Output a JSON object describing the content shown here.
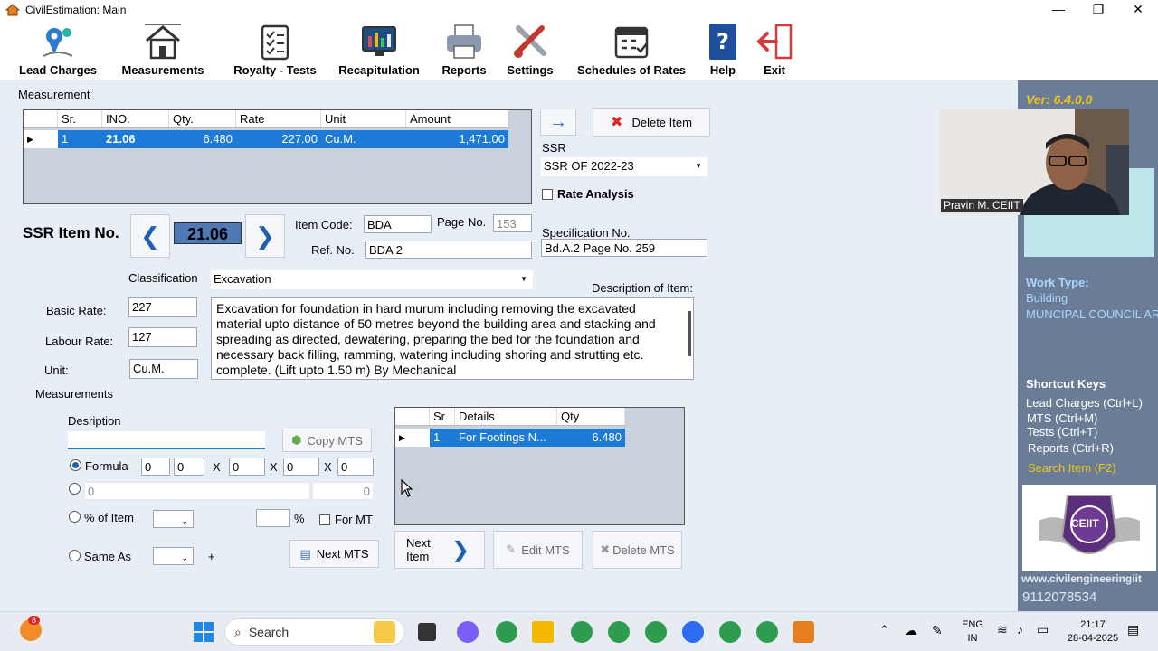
{
  "window": {
    "title": "CivilEstimation: Main",
    "controls": [
      "—",
      "❐",
      "✕"
    ]
  },
  "toolbar": [
    {
      "label": "Lead Charges",
      "icon": "map-pin-icon"
    },
    {
      "label": "Measurements",
      "icon": "house-icon"
    },
    {
      "label": "Royalty - Tests",
      "icon": "checklist-icon"
    },
    {
      "label": "Recapitulation",
      "icon": "chart-monitor-icon"
    },
    {
      "label": "Reports",
      "icon": "printer-icon"
    },
    {
      "label": "Settings",
      "icon": "tools-icon"
    },
    {
      "label": "Schedules of Rates",
      "icon": "calendar-icon"
    },
    {
      "label": "Help",
      "icon": "help-book-icon"
    },
    {
      "label": "Exit",
      "icon": "exit-icon"
    }
  ],
  "measurement": {
    "section_label": "Measurement",
    "columns": [
      "Sr.",
      "INO.",
      "Qty.",
      "Rate",
      "Unit",
      "Amount"
    ],
    "rows": [
      {
        "sr": "1",
        "ino": "21.06",
        "qty": "6.480",
        "rate": "227.00",
        "unit": "Cu.M.",
        "amount": "1,471.00"
      }
    ]
  },
  "actions": {
    "arrow": "→",
    "delete_item": "Delete Item"
  },
  "ssr": {
    "label": "SSR",
    "value": "SSR OF 2022-23",
    "rate_analysis": "Rate Analysis"
  },
  "item": {
    "ssr_item_label": "SSR Item No.",
    "ssr_item_no": "21.06",
    "item_code_label": "Item Code:",
    "item_code": "BDA",
    "page_no_label": "Page No.",
    "page_no": "153",
    "ref_no_label": "Ref. No.",
    "ref_no": "BDA 2",
    "spec_label": "Specification No.",
    "spec_no": "Bd.A.2 Page No. 259",
    "classification_label": "Classification",
    "classification": "Excavation",
    "description_label": "Description of Item:",
    "description": "Excavation for foundation in hard murum including removing the excavated material upto distance of 50 metres beyond the building area and stacking and spreading as directed, dewatering, preparing the bed for the foundation and necessary back filling, ramming, watering including shoring and strutting etc. complete. (Lift upto 1.50 m) By Mechanical",
    "basic_rate_label": "Basic Rate:",
    "basic_rate": "227",
    "labour_rate_label": "Labour Rate:",
    "labour_rate": "127",
    "unit_label": "Unit:",
    "unit": "Cu.M."
  },
  "mts": {
    "section_label": "Measurements",
    "desc_label": "Desription",
    "desc_value": "",
    "copy_mts": "Copy MTS",
    "formula_label": "Formula",
    "formula_values": [
      "0",
      "0",
      "0",
      "0",
      "0"
    ],
    "x_sign": "X",
    "free_value": "0",
    "free_total": "0",
    "pct_label": "% of Item",
    "pct_sign": "%",
    "for_mt": "For MT",
    "same_as": "Same As",
    "plus": "+",
    "next_mts": "Next MTS",
    "next_item": "Next Item",
    "edit_mts": "Edit MTS",
    "delete_mts": "Delete MTS",
    "grid_columns": [
      "Sr",
      "Details",
      "Qty"
    ],
    "grid_rows": [
      {
        "sr": "1",
        "details": "For Footings N...",
        "qty": "6.480"
      }
    ]
  },
  "rightpane": {
    "version": "Ver: 6.4.0.0",
    "webcam_name": "Pravin M. CEIIT",
    "work_type_label": "Work Type:",
    "work_type": "Building",
    "council": "MUNCIPAL COUNCIL AR",
    "shortcut_title": "Shortcut Keys",
    "shortcuts": [
      "Lead Charges (Ctrl+L)",
      "MTS (Ctrl+M)",
      "Tests (Ctrl+T)",
      "Reports (Ctrl+R)"
    ],
    "search_item": "Search Item (F2)",
    "logo_text": "CEIIT",
    "website": "www.civilengineeringiit",
    "phone": "9112078534"
  },
  "taskbar": {
    "search": "Search",
    "badge": "8",
    "lang_top": "ENG",
    "lang_bottom": "IN",
    "time": "21:17",
    "date": "28-04-2025"
  }
}
